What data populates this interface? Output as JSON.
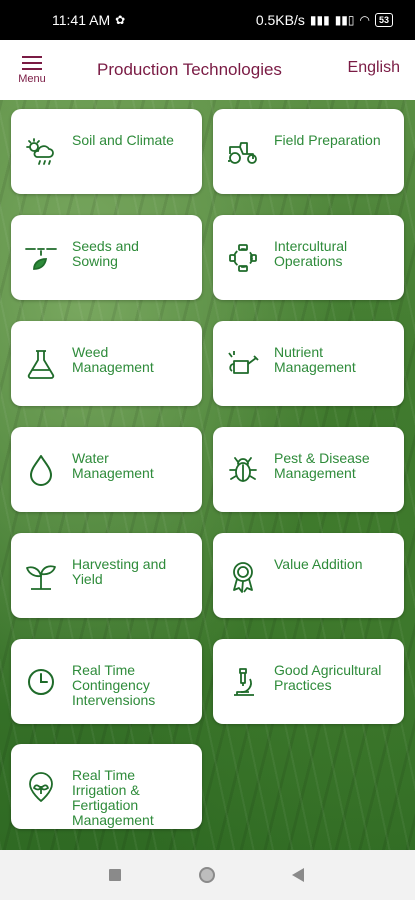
{
  "status_bar": {
    "time": "11:41 AM",
    "network_speed": "0.5KB/s",
    "battery": "53"
  },
  "header": {
    "menu_label": "Menu",
    "title": "Production Technologies",
    "language": "English"
  },
  "colors": {
    "brand": "#7a1b44",
    "tile_text": "#2e8b3a",
    "icon": "#1f6b2a"
  },
  "tiles": [
    {
      "label": "Soil and Climate",
      "icon": "soil-climate-icon"
    },
    {
      "label": "Field Preparation",
      "icon": "tractor-icon"
    },
    {
      "label": "Seeds and\nSowing",
      "icon": "seed-sowing-icon"
    },
    {
      "label": "Intercultural\nOperations",
      "icon": "cycle-icon"
    },
    {
      "label": "Weed\nManagement",
      "icon": "flask-icon"
    },
    {
      "label": "Nutrient\nManagement",
      "icon": "watering-can-icon"
    },
    {
      "label": "Water\nManagement",
      "icon": "water-drop-icon"
    },
    {
      "label": "Pest & Disease\nManagement",
      "icon": "bug-icon"
    },
    {
      "label": "Harvesting and\nYield",
      "icon": "sprout-icon"
    },
    {
      "label": "Value Addition",
      "icon": "award-icon"
    },
    {
      "label": "Real Time\nContingency\nIntervensions",
      "icon": "clock-icon"
    },
    {
      "label": "Good Agricultural\nPractices",
      "icon": "microscope-icon"
    },
    {
      "label": "Real Time\nIrrigation &\nFertigation\nManagement",
      "icon": "irrigation-icon"
    }
  ],
  "nav": {
    "recent": "recent-apps-icon",
    "home": "home-icon",
    "back": "back-icon"
  }
}
